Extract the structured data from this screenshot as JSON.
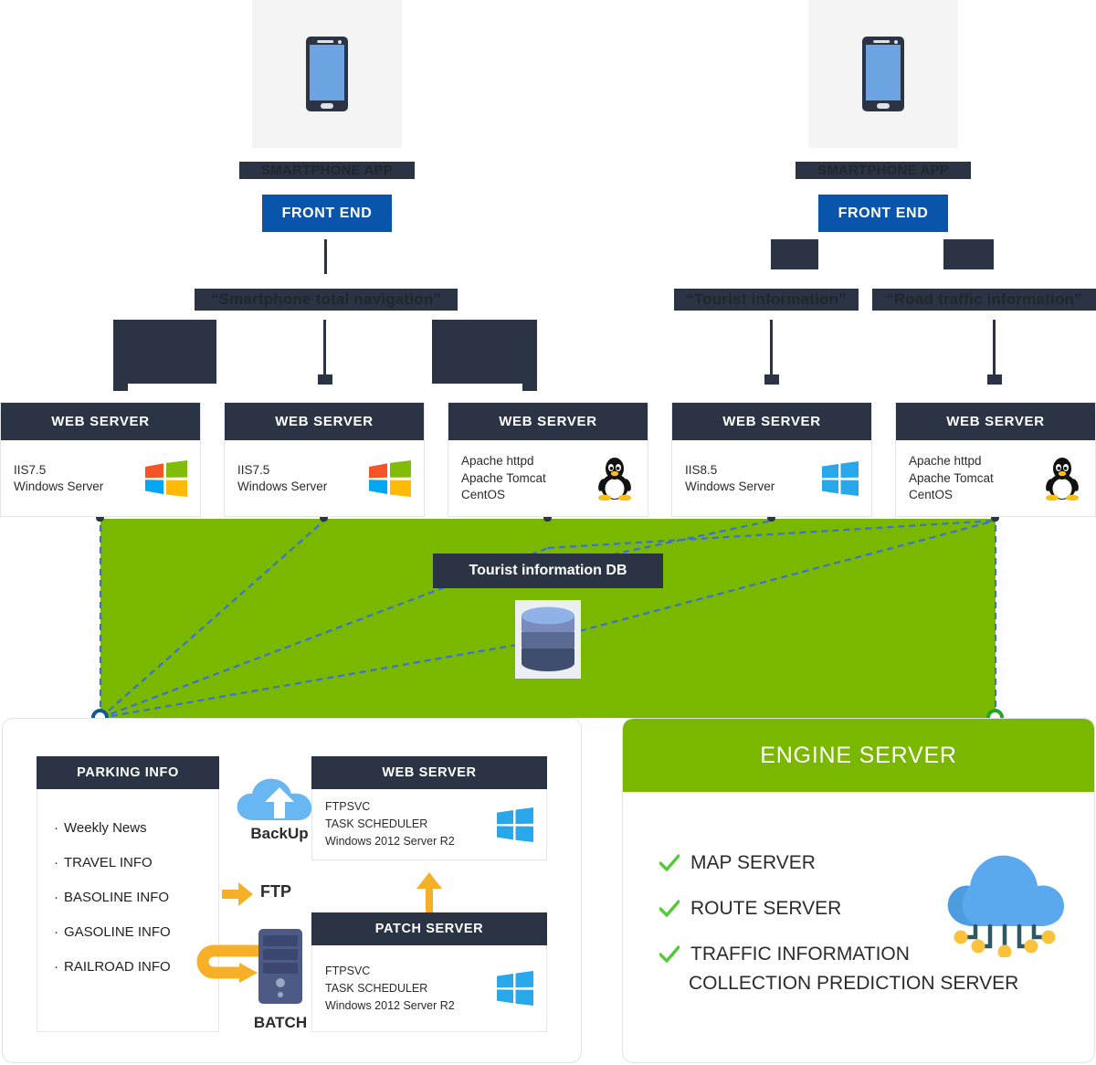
{
  "top": {
    "phones": [
      {
        "caption": "SMARTPHONE APP"
      },
      {
        "caption": "SMARTPHONE APP"
      }
    ],
    "frontend_left": "FRONT END",
    "frontend_right": "FRONT END",
    "channels": [
      {
        "label": "“Smartphone total navigation”"
      },
      {
        "label": "“Tourist information”"
      },
      {
        "label": "“Road traffic information”"
      }
    ]
  },
  "web_servers": [
    {
      "title": "WEB SERVER",
      "specs": "IIS7.5\nWindows Server",
      "os": "windows-old"
    },
    {
      "title": "WEB SERVER",
      "specs": "IIS7.5\nWindows Server",
      "os": "windows-old"
    },
    {
      "title": "WEB SERVER",
      "specs": "Apache httpd\nApache Tomcat\nCentOS",
      "os": "linux"
    },
    {
      "title": "WEB SERVER",
      "specs": "IIS8.5\nWindows Server",
      "os": "windows-new"
    },
    {
      "title": "WEB SERVER",
      "specs": "Apache httpd\nApache Tomcat\nCentOS",
      "os": "linux"
    }
  ],
  "database": {
    "label": "Tourist information DB",
    "icon": "database-icon"
  },
  "parking_panel": {
    "header": "PARKING INFO",
    "items": [
      "Weekly News",
      "TRAVEL INFO",
      "BASOLINE INFO",
      "GASOLINE INFO",
      "RAILROAD INFO"
    ],
    "backup_label": "BackUp",
    "ftp_label": "FTP",
    "batch_label": "BATCH",
    "web_server": {
      "header": "WEB SERVER",
      "specs": "FTPSVC\nTASK SCHEDULER\nWindows 2012 Server R2"
    },
    "patch_server": {
      "header": "PATCH SERVER",
      "specs": "FTPSVC\nTASK SCHEDULER\nWindows 2012 Server R2"
    }
  },
  "engine_panel": {
    "header": "ENGINE SERVER",
    "items": [
      "MAP SERVER",
      "ROUTE SERVER",
      "TRAFFIC INFORMATION"
    ],
    "continuation": "COLLECTION PREDICTION SERVER"
  },
  "colors": {
    "dark": "#2b3444",
    "blue": "#0a55ac",
    "green": "#7ab800",
    "check_green": "#55c83c",
    "orange": "#f5b028",
    "link_blue": "#3a6fe0"
  }
}
